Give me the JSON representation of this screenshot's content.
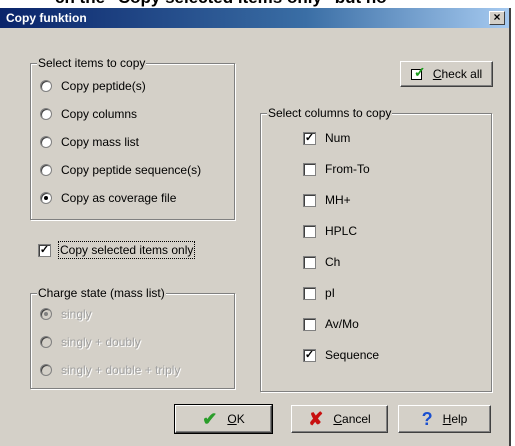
{
  "background_text": "ch the \"Copy selected items only\" but no",
  "window": {
    "title": "Copy funktion",
    "close_label": "×"
  },
  "select_items": {
    "legend": "Select items to copy",
    "options": [
      {
        "label": "Copy peptide(s)",
        "selected": false
      },
      {
        "label": "Copy columns",
        "selected": false
      },
      {
        "label": "Copy mass list",
        "selected": false
      },
      {
        "label": "Copy peptide sequence(s)",
        "selected": false
      },
      {
        "label": "Copy as coverage file",
        "selected": true
      }
    ]
  },
  "copy_selected_only": {
    "label": "Copy selected items only",
    "checked": true
  },
  "charge_state": {
    "legend": "Charge state (mass list)",
    "options": [
      {
        "label": "singly",
        "selected": true
      },
      {
        "label": "singly + doubly",
        "selected": false
      },
      {
        "label": "singly + double + triply",
        "selected": false
      }
    ]
  },
  "check_all": {
    "label_pre": "C",
    "label_rest": "heck all",
    "icon": "checkmark-icon"
  },
  "select_columns": {
    "legend": "Select columns to copy",
    "columns": [
      {
        "label": "Num",
        "checked": true
      },
      {
        "label": "From-To",
        "checked": false
      },
      {
        "label": "MH+",
        "checked": false
      },
      {
        "label": "HPLC",
        "checked": false
      },
      {
        "label": "Ch",
        "checked": false
      },
      {
        "label": "pI",
        "checked": false
      },
      {
        "label": "Av/Mo",
        "checked": false
      },
      {
        "label": "Sequence",
        "checked": true
      }
    ]
  },
  "buttons": {
    "ok": {
      "label_pre": "O",
      "label_rest": "K",
      "icon": "green-check-icon",
      "glyph": "✔",
      "color": "#2a9d2a"
    },
    "cancel": {
      "label_pre": "C",
      "label_rest": "ancel",
      "icon": "red-x-icon",
      "glyph": "✘",
      "color": "#c81010"
    },
    "help": {
      "label_pre": "H",
      "label_rest": "elp",
      "icon": "help-question-icon",
      "glyph": "?",
      "color": "#1a4fd0"
    }
  }
}
